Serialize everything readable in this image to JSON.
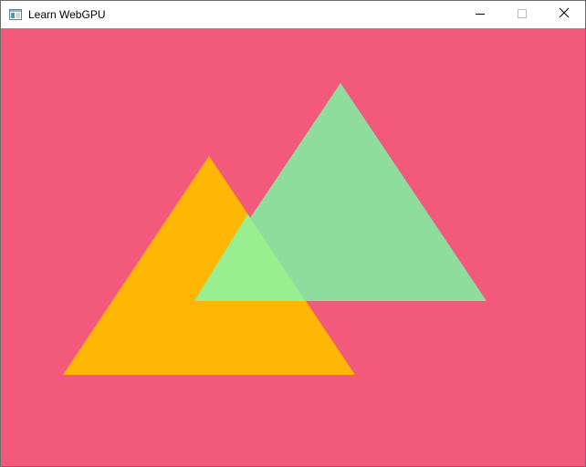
{
  "window": {
    "title": "Learn WebGPU",
    "app_icon": "window-app-icon",
    "controls": {
      "minimize_icon": "minimize-icon",
      "maximize_icon": "maximize-icon",
      "close_icon": "close-icon"
    }
  },
  "scene": {
    "clear_color": "#F2597B",
    "triangles": [
      {
        "name": "orange-triangle",
        "color": "#FFB703"
      },
      {
        "name": "green-triangle",
        "color": "#8EDD9F"
      }
    ],
    "overlap_color": "#99EE8F"
  }
}
